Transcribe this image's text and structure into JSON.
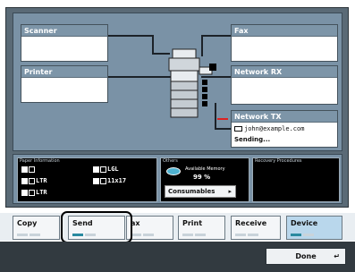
{
  "status": {
    "scanner": "Scanner",
    "printer": "Printer",
    "fax": "Fax",
    "network_rx": "Network RX",
    "network_tx": "Network TX",
    "tx_address": "john@example.com",
    "tx_state": "Sending..."
  },
  "info": {
    "paper_title": "Paper Information",
    "paper": {
      "drawer1": "1",
      "drawer2": "LTR",
      "drawer3": "LTR",
      "tray3": "LGL",
      "tray4": "11x17"
    },
    "others_title": "Others",
    "memory_label": "Available Memory",
    "memory_value": "99 %",
    "memory_percent": 99,
    "consumables": "Consumables",
    "recovery_title": "Recovery Procedures"
  },
  "tabs": [
    {
      "label": "Copy"
    },
    {
      "label": "Send"
    },
    {
      "label": "ax"
    },
    {
      "label": "Print"
    },
    {
      "label": "Receive"
    },
    {
      "label": "Device"
    }
  ],
  "done_label": "Done",
  "colors": {
    "panel": "#5a6a76",
    "status_bg": "#7a92a6",
    "active_tab": "#b9d7ec"
  }
}
